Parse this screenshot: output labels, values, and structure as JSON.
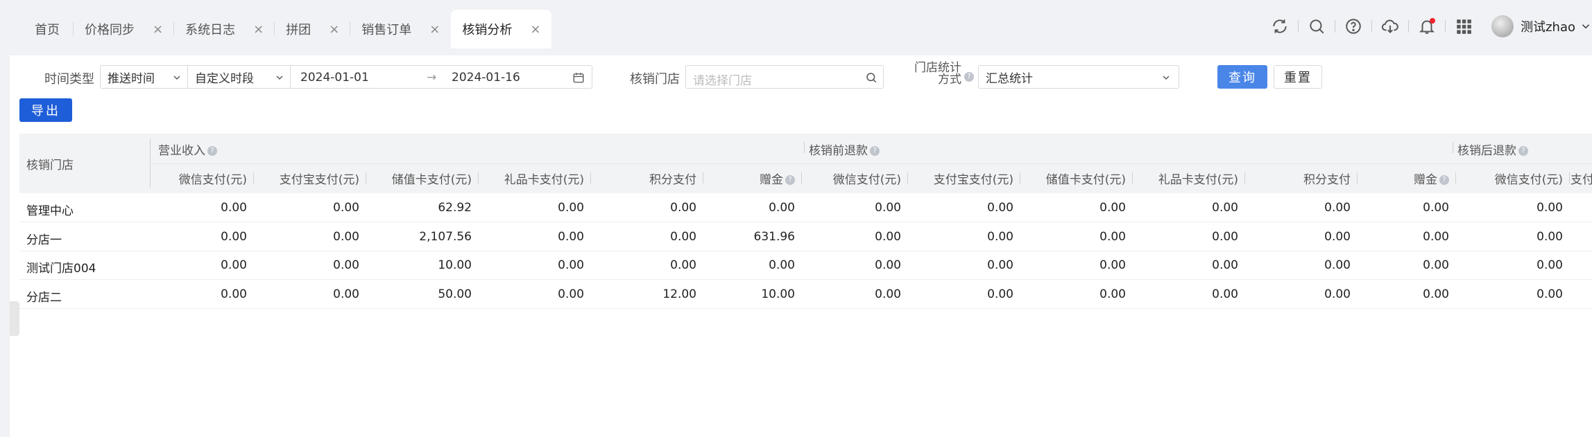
{
  "tabs": [
    {
      "label": "首页",
      "closable": false,
      "active": false
    },
    {
      "label": "价格同步",
      "closable": true,
      "active": false
    },
    {
      "label": "系统日志",
      "closable": true,
      "active": false
    },
    {
      "label": "拼团",
      "closable": true,
      "active": false
    },
    {
      "label": "销售订单",
      "closable": true,
      "active": false
    },
    {
      "label": "核销分析",
      "closable": true,
      "active": true
    }
  ],
  "close_glyph": "×",
  "user": {
    "name": "测试zhao"
  },
  "filters": {
    "time_type_label": "时间类型",
    "time_type_value": "推送时间",
    "period_value": "自定义时段",
    "date_start": "2024-01-01",
    "date_arrow": "→",
    "date_end": "2024-01-16",
    "store_label": "核销门店",
    "store_placeholder": "请选择门店",
    "stat_label_line1": "门店统计",
    "stat_label_line2": "方式",
    "stat_value": "汇总统计",
    "query_btn": "查询",
    "reset_btn": "重置",
    "export_btn": "导出"
  },
  "table": {
    "store_col": "核销门店",
    "groups": [
      "营业收入",
      "核销前退款",
      "核销后退款"
    ],
    "sub_headers": [
      "微信支付(元)",
      "支付宝支付(元)",
      "储值卡支付(元)",
      "礼品卡支付(元)",
      "积分支付",
      "赠金",
      "微信支付(元)",
      "支付宝支付(元)",
      "储值卡支付(元)",
      "礼品卡支付(元)",
      "积分支付",
      "赠金",
      "微信支付(元)",
      "支付"
    ],
    "rows": [
      {
        "store": "管理中心",
        "values": [
          "0.00",
          "0.00",
          "62.92",
          "0.00",
          "0.00",
          "0.00",
          "0.00",
          "0.00",
          "0.00",
          "0.00",
          "0.00",
          "0.00",
          "0.00"
        ]
      },
      {
        "store": "分店一",
        "values": [
          "0.00",
          "0.00",
          "2,107.56",
          "0.00",
          "0.00",
          "631.96",
          "0.00",
          "0.00",
          "0.00",
          "0.00",
          "0.00",
          "0.00",
          "0.00"
        ]
      },
      {
        "store": "测试门店004",
        "values": [
          "0.00",
          "0.00",
          "10.00",
          "0.00",
          "0.00",
          "0.00",
          "0.00",
          "0.00",
          "0.00",
          "0.00",
          "0.00",
          "0.00",
          "0.00"
        ]
      },
      {
        "store": "分店二",
        "values": [
          "0.00",
          "0.00",
          "50.00",
          "0.00",
          "12.00",
          "10.00",
          "0.00",
          "0.00",
          "0.00",
          "0.00",
          "0.00",
          "0.00",
          "0.00"
        ]
      }
    ]
  }
}
